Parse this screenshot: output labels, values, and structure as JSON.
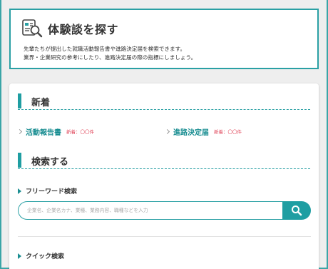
{
  "intro": {
    "icon": "report-search-icon",
    "title": "体験談を探す",
    "lines": [
      "先輩たちが提出した就職活動報告書や進路決定届を検索できます。",
      "業界・企業研究の参考にしたり、進路決定届の際の指標にしましょう。"
    ]
  },
  "news": {
    "title": "新着",
    "items": [
      {
        "label": "活動報告書",
        "count": "新着：〇〇件"
      },
      {
        "label": "進路決定届",
        "count": "新着：〇〇件"
      }
    ]
  },
  "search": {
    "title": "検索する",
    "freeword": {
      "title": "フリーワード検索",
      "placeholder": "企業名、企業名カナ、業種、業務内容、職種などを入力",
      "button_icon": "search-icon"
    },
    "quick": {
      "title": "クイック検索"
    }
  },
  "colors": {
    "accent": "#1f9ea2",
    "link": "#1a8e92",
    "badge": "#e0465a"
  }
}
